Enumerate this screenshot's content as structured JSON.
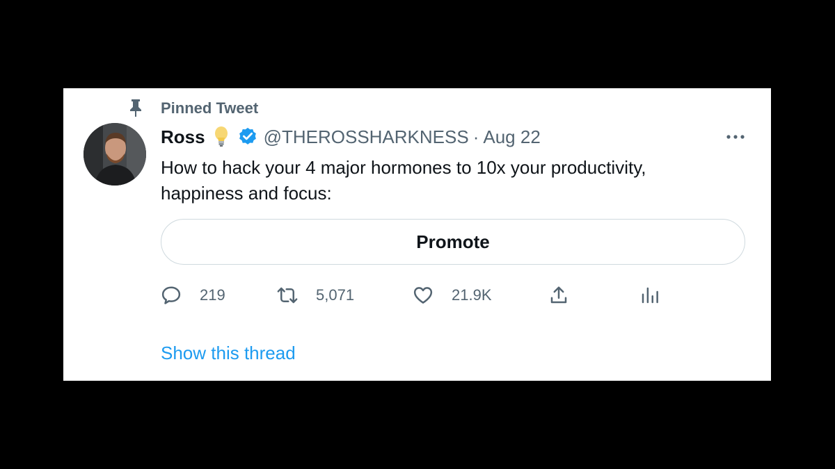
{
  "pinned": {
    "label": "Pinned Tweet",
    "icon": "pin-icon"
  },
  "author": {
    "name": "Ross",
    "emoji_icon": "lightbulb-icon",
    "verified_icon": "verified-badge-icon",
    "handle": "@THEROSSHARKNESS",
    "separator": "·",
    "date": "Aug 22"
  },
  "tweet": {
    "text": "How to hack your 4 major hormones to 10x your productivity, happiness and focus:"
  },
  "promote": {
    "label": "Promote"
  },
  "actions": {
    "reply": {
      "icon": "reply-icon",
      "count": "219"
    },
    "retweet": {
      "icon": "retweet-icon",
      "count": "5,071"
    },
    "like": {
      "icon": "heart-icon",
      "count": "21.9K"
    },
    "share": {
      "icon": "share-icon"
    },
    "analytics": {
      "icon": "analytics-icon"
    }
  },
  "thread_link": "Show this thread",
  "colors": {
    "background": "#000000",
    "card": "#ffffff",
    "primary_text": "#0f1419",
    "secondary_text": "#536471",
    "link": "#1d9bf0",
    "verified": "#1d9bf0",
    "border": "#cfd9de"
  }
}
